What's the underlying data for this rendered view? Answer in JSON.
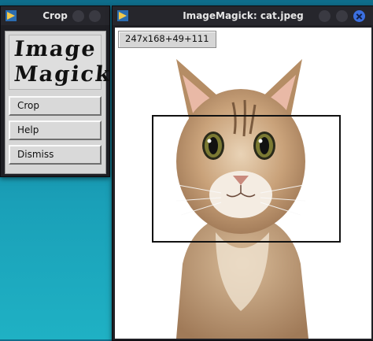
{
  "crop_window": {
    "title": "Crop",
    "logo_text": [
      "Image",
      "Magick"
    ],
    "buttons": [
      {
        "label": "Crop"
      },
      {
        "label": "Help"
      },
      {
        "label": "Dismiss"
      }
    ]
  },
  "image_window": {
    "title": "ImageMagick: cat.jpeg",
    "geometry_readout": "247x168+49+111"
  },
  "colors": {
    "desktop": "#1aa0b8",
    "titlebar": "#26262c",
    "close_button": "#3b6fe0",
    "panel": "#d6d6d6"
  }
}
